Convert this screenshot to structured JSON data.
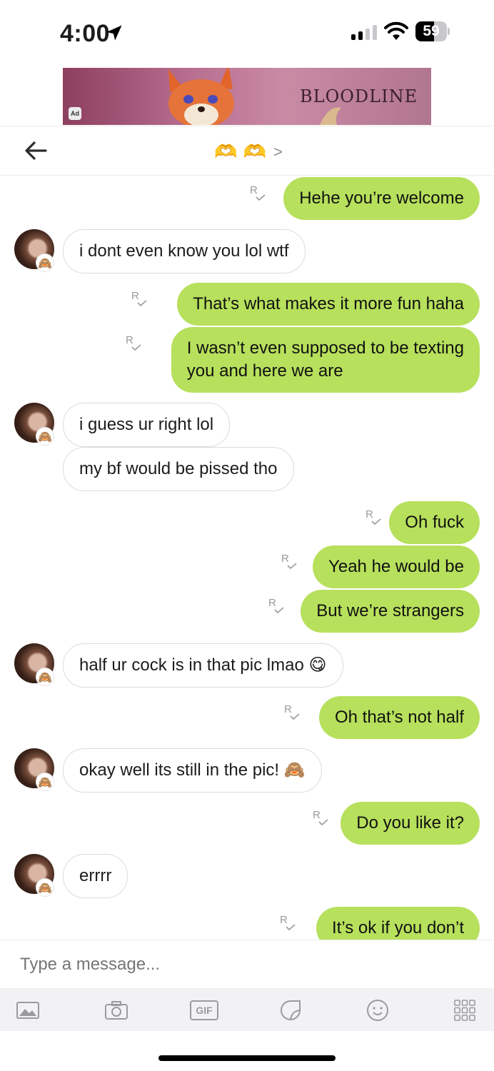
{
  "status_bar": {
    "time": "4:00",
    "battery": "59",
    "battery_level": 0.59
  },
  "ad": {
    "title": "BLOODLINE",
    "badge": "Ad"
  },
  "header": {
    "title": "🫶 🫶",
    "chevron": ">"
  },
  "messages": [
    {
      "side": "out",
      "text": "Hehe you’re welcome"
    },
    {
      "side": "in",
      "text": "i dont even know you lol wtf"
    },
    {
      "side": "out",
      "text": "That’s what makes it more fun haha"
    },
    {
      "side": "out",
      "text": "I wasn’t even supposed to be texting\nyou and here we are"
    },
    {
      "side": "in",
      "text": "i guess ur right lol"
    },
    {
      "side": "in",
      "text": "my bf would be pissed tho"
    },
    {
      "side": "out",
      "text": "Oh fuck"
    },
    {
      "side": "out",
      "text": "Yeah he would be"
    },
    {
      "side": "out",
      "text": "But we’re strangers"
    },
    {
      "side": "in",
      "text": "half ur cock is in that pic lmao 😋"
    },
    {
      "side": "out",
      "text": "Oh that’s not half"
    },
    {
      "side": "in",
      "text": "okay well its still in the pic! 🙈"
    },
    {
      "side": "out",
      "text": "Do you like it?"
    },
    {
      "side": "in",
      "text": "errrr"
    },
    {
      "side": "out",
      "text": "It’s ok if you don’t"
    }
  ],
  "read_receipt": "R",
  "avatar_badge": "🙈",
  "composer": {
    "placeholder": "Type a message..."
  },
  "toolbar": {
    "gif_label": "GIF",
    "icons": [
      "photo-icon",
      "camera-icon",
      "gif-icon",
      "sticker-icon",
      "emoji-icon",
      "grid-icon"
    ]
  },
  "colors": {
    "outgoing_bubble": "#b7e05c",
    "incoming_border": "#dcdce0"
  }
}
